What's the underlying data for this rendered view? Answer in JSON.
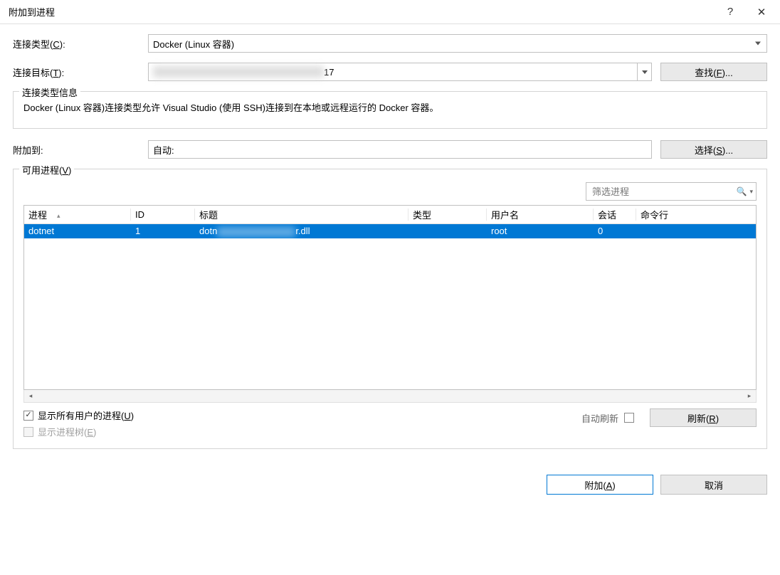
{
  "window": {
    "title": "附加到进程"
  },
  "form": {
    "connectionTypeLabel": "连接类型(C):",
    "connectionTypeValue": "Docker (Linux 容器)",
    "connectionTargetLabel": "连接目标(T):",
    "connectionTargetValue": "17",
    "findButton": "查找(F)...",
    "attachToLabel": "附加到:",
    "attachToValue": "自动:",
    "selectButton": "选择(S)..."
  },
  "typeInfo": {
    "legend": "连接类型信息",
    "text": "Docker (Linux 容器)连接类型允许 Visual Studio (使用 SSH)连接到在本地或远程运行的 Docker 容器。"
  },
  "processes": {
    "legend": "可用进程(V)",
    "filterPlaceholder": "筛选进程",
    "columns": {
      "process": "进程",
      "id": "ID",
      "title": "标题",
      "type": "类型",
      "user": "用户名",
      "session": "会话",
      "cmdline": "命令行"
    },
    "rows": [
      {
        "process": "dotnet",
        "id": "1",
        "title_prefix": "dotn",
        "title_hidden": "xxxxxxxx",
        "title_suffix": "r.dll",
        "type": "",
        "user": "root",
        "session": "0",
        "cmdline": ""
      }
    ],
    "showAllUsers": "显示所有用户的进程(U)",
    "showProcessTree": "显示进程树(E)",
    "autoRefreshLabel": "自动刷新",
    "refreshButton": "刷新(R)"
  },
  "footer": {
    "attach": "附加(A)",
    "cancel": "取消"
  }
}
